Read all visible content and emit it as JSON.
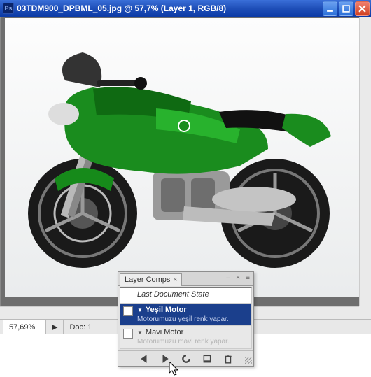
{
  "window": {
    "app_icon_text": "Ps",
    "title": "03TDM900_DPBML_05.jpg @ 57,7% (Layer 1, RGB/8)"
  },
  "status": {
    "zoom": "57,69%",
    "doc_label": "Doc: 1",
    "arrow": "▶"
  },
  "panel": {
    "tab_label": "Layer Comps",
    "last_state": "Last Document State",
    "items": [
      {
        "name": "Yeşil Motor",
        "desc": "Motorumuzu yeşil renk yapar."
      },
      {
        "name": "Mavi Motor",
        "desc": "Motorumuzu mavi renk yapar."
      }
    ],
    "footer_icons": {
      "prev": "prev-comp-icon",
      "next": "next-comp-icon",
      "update": "update-comp-icon",
      "new": "new-comp-icon",
      "delete": "delete-comp-icon"
    }
  },
  "canvas": {
    "subject": "motorcycle",
    "body_color": "#1a8c1e",
    "wheel_color": "#222"
  }
}
